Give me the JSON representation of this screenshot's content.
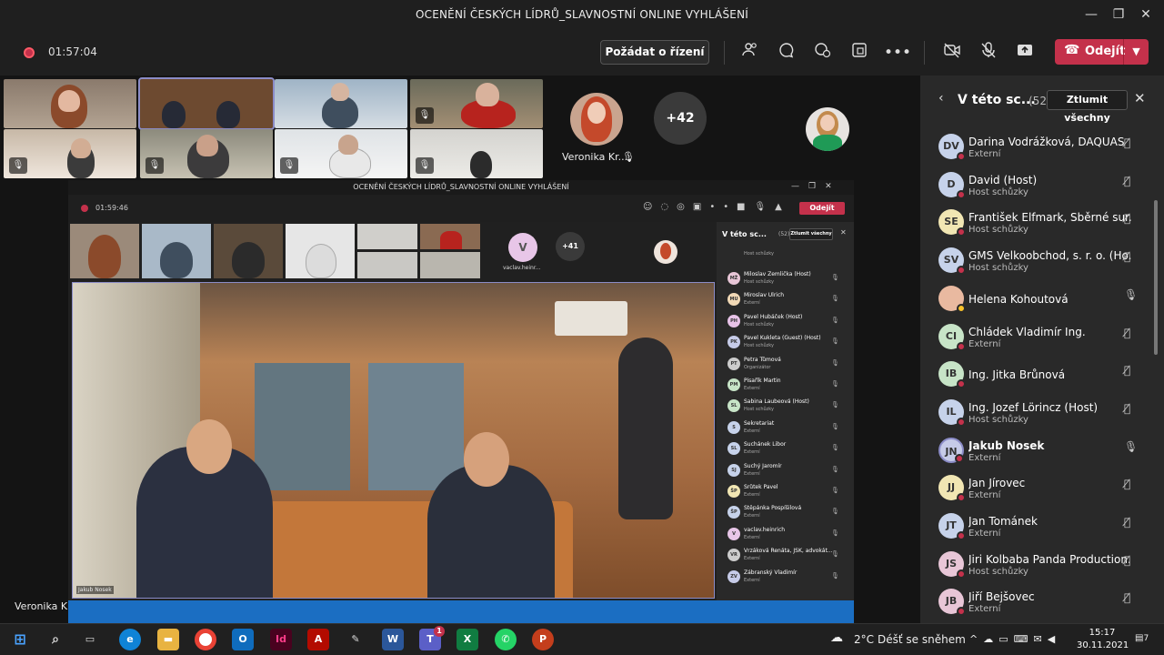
{
  "window": {
    "title": "OCENĚNÍ ČESKÝCH LÍDRŮ_SLAVNOSTNÍ ONLINE VYHLÁŠENÍ"
  },
  "toolbar": {
    "timer": "01:57:04",
    "request_control": "Požádat o řízení",
    "leave": "Odejít"
  },
  "stage": {
    "featured_name": "Veronika Kr...",
    "more_count": "+42",
    "self_name": "Veronika Krnáčová"
  },
  "inner": {
    "title": "OCENĚNÍ ČESKÝCH LÍDRŮ_SLAVNOSTNÍ ONLINE VYHLÁŠENÍ",
    "timer": "01:59:46",
    "leave": "Odejít",
    "panel_title": "V této sc...",
    "panel_count": "(52)",
    "mute_all": "Ztlumit všechny",
    "more_count": "+41",
    "featured_initial": "V",
    "featured_name": "vaclav.heinr...",
    "speaker_name": "Jakub Nosek",
    "top_role": "Host schůzky",
    "participants": [
      {
        "name": "Miloslav Žemlička (Host)",
        "role": "Host schůzky",
        "initials": "MŽ",
        "color": "#e8c6d7"
      },
      {
        "name": "Miroslav Ulrich",
        "role": "Externí",
        "initials": "MU",
        "color": "#f1d9b6"
      },
      {
        "name": "Pavel Hubáček (Host)",
        "role": "Host schůzky",
        "initials": "PH",
        "color": "#e7c2e7"
      },
      {
        "name": "Pavel Kukleta (Guest) (Host)",
        "role": "Host schůzky",
        "initials": "PK",
        "color": "#c6cbe8"
      },
      {
        "name": "Petra Tůmová",
        "role": "Organizátor",
        "initials": "PT",
        "color": "#cccccc"
      },
      {
        "name": "Pisařík Martin",
        "role": "Externí",
        "initials": "PM",
        "color": "#c7e4c7"
      },
      {
        "name": "Sabina Laubeová (Host)",
        "role": "Host schůzky",
        "initials": "SL",
        "color": "#c7e4c7"
      },
      {
        "name": "Sekretariat",
        "role": "Externí",
        "initials": "S",
        "color": "#c6d2ea"
      },
      {
        "name": "Suchánek Libor",
        "role": "Externí",
        "initials": "SL",
        "color": "#c6d2ea"
      },
      {
        "name": "Suchý Jaromír",
        "role": "Externí",
        "initials": "SJ",
        "color": "#c6d2ea"
      },
      {
        "name": "Šrůtek Pavel",
        "role": "Externí",
        "initials": "ŠP",
        "color": "#f1e6b3"
      },
      {
        "name": "Štěpánka Pospíšilová",
        "role": "Externí",
        "initials": "ŠP",
        "color": "#c6d2ea"
      },
      {
        "name": "vaclav.heinrich",
        "role": "Externí",
        "initials": "V",
        "color": "#e8c6e8"
      },
      {
        "name": "Vrzáková Renáta, JŠK, advokát...",
        "role": "Externí",
        "initials": "VR",
        "color": "#cccccc"
      },
      {
        "name": "Zábranský Vladimír",
        "role": "Externí",
        "initials": "ZV",
        "color": "#c6cbe8"
      }
    ]
  },
  "panel": {
    "title": "V této sc...",
    "count": "(52)",
    "mute_all": "Ztlumit všechny",
    "participants": [
      {
        "name": "Darina Vodrážková, DAQUAS",
        "role": "Externí",
        "initials": "DV",
        "color": "#c6d2ea",
        "mic": "muted"
      },
      {
        "name": "David (Host)",
        "role": "Host schůzky",
        "initials": "D",
        "color": "#c6d2ea",
        "mic": "muted"
      },
      {
        "name": "František Elfmark, Sběrné sur...",
        "role": "Host schůzky",
        "initials": "SE",
        "color": "#f1e6b3",
        "mic": "muted"
      },
      {
        "name": "GMS Velkoobchod, s. r. o. (Ho...",
        "role": "Host schůzky",
        "initials": "SV",
        "color": "#c6d2ea",
        "mic": "muted"
      },
      {
        "name": "Helena Kohoutová",
        "role": "",
        "initials": "",
        "color": "#e9b9a0",
        "mic": "on"
      },
      {
        "name": "Chládek Vladimír Ing.",
        "role": "Externí",
        "initials": "CI",
        "color": "#c7e4c7",
        "mic": "muted"
      },
      {
        "name": "Ing. Jitka Brůnová",
        "role": "",
        "initials": "IB",
        "color": "#c7e4c7",
        "mic": "muted"
      },
      {
        "name": "Ing. Jozef Lörincz (Host)",
        "role": "Host schůzky",
        "initials": "IL",
        "color": "#c6d2ea",
        "mic": "muted"
      },
      {
        "name": "Jakub Nosek",
        "role": "Externí",
        "initials": "JN",
        "color": "#c6cbe8",
        "mic": "on"
      },
      {
        "name": "Jan Jírovec",
        "role": "Externí",
        "initials": "JJ",
        "color": "#f1e6b3",
        "mic": "muted"
      },
      {
        "name": "Jan Tománek",
        "role": "Externí",
        "initials": "JT",
        "color": "#c6d2ea",
        "mic": "muted"
      },
      {
        "name": "Jiri Kolbaba Panda Production...",
        "role": "Host schůzky",
        "initials": "JS",
        "color": "#e8c6d7",
        "mic": "muted"
      },
      {
        "name": "Jiří Bejšovec",
        "role": "Externí",
        "initials": "JB",
        "color": "#e8c6d7",
        "mic": "muted"
      }
    ]
  },
  "taskbar": {
    "weather_temp": "2°C",
    "weather_text": "Déšť se sněhem",
    "time": "15:17",
    "date": "30.11.2021",
    "notifications": "7",
    "teams_badge": "1"
  },
  "colors": {
    "leave": "#c4314b",
    "panel_bg": "#292929",
    "accent": "#6264a7"
  }
}
